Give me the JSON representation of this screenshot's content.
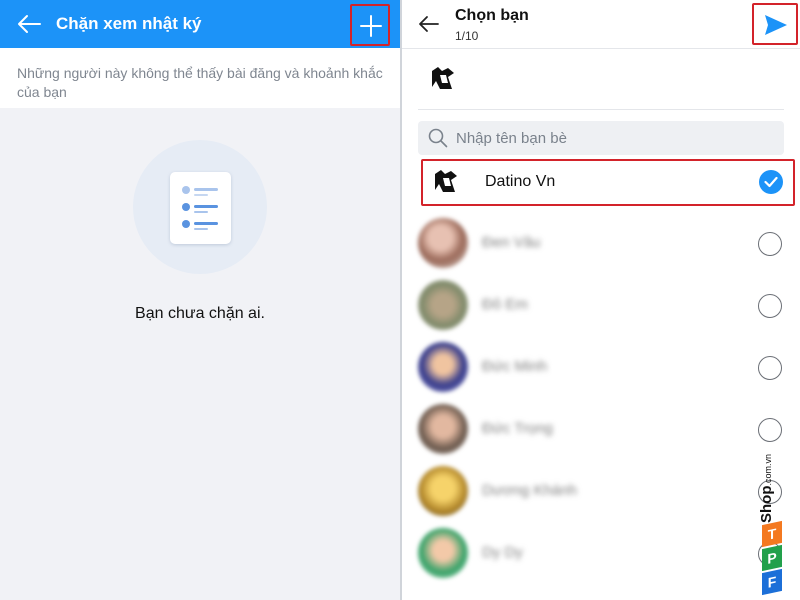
{
  "left_screen": {
    "header": {
      "title": "Chặn xem nhật ký",
      "back_icon": "arrow-left-icon",
      "add_icon": "plus-icon"
    },
    "description": "Những người này không thể thấy bài đăng và khoảnh khắc của bạn",
    "empty_state": {
      "icon": "document-list-icon",
      "message": "Bạn chưa chặn ai."
    }
  },
  "right_screen": {
    "header": {
      "title": "Chọn bạn",
      "count": "1/10",
      "back_icon": "arrow-left-icon",
      "send_icon": "send-icon"
    },
    "search": {
      "placeholder": "Nhập tên bạn bè",
      "value": ""
    },
    "selected_contact": {
      "name": "Datino Vn",
      "checked": true
    },
    "contacts": [
      {
        "name": "Đen Vâu",
        "checked": false
      },
      {
        "name": "Đô Em",
        "checked": false
      },
      {
        "name": "Đức Minh",
        "checked": false
      },
      {
        "name": "Đức Trọng",
        "checked": false
      },
      {
        "name": "Dương Khánh",
        "checked": false
      },
      {
        "name": "Dy Dy",
        "checked": false
      }
    ]
  },
  "watermark": {
    "brand": "FPT",
    "text": "Shop",
    "suffix": ".com.vn"
  },
  "colors": {
    "header_blue": "#1c93f8",
    "highlight_red": "#d3232a",
    "check_blue": "#1c93f8"
  }
}
